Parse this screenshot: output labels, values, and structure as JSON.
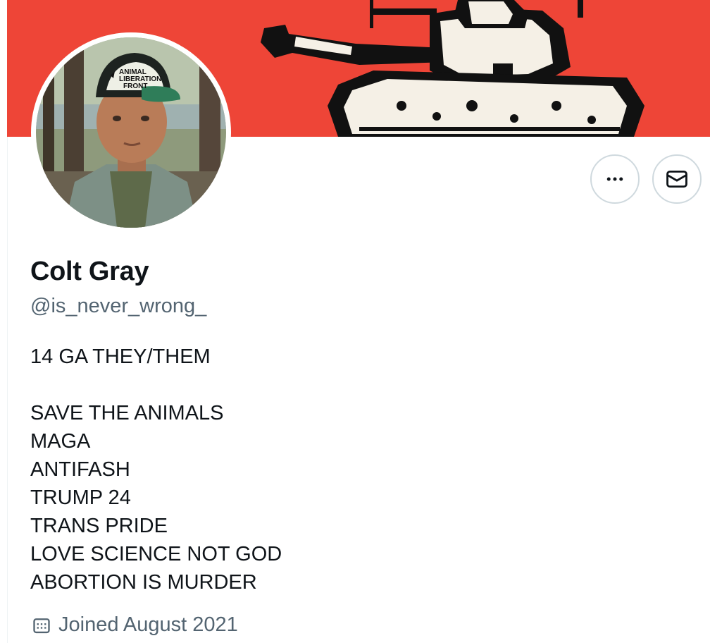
{
  "profile": {
    "display_name": "Colt Gray",
    "handle": "@is_never_wrong_",
    "bio_lines": [
      "14 GA THEY/THEM",
      "",
      "SAVE THE ANIMALS",
      "MAGA",
      "ANTIFASH",
      "TRUMP 24",
      "TRANS PRIDE",
      "LOVE SCIENCE NOT GOD",
      "ABORTION IS MURDER"
    ],
    "joined": "Joined August 2021",
    "hat_text": [
      "ANIMAL",
      "LIBERATION",
      "FRONT"
    ]
  },
  "actions": {
    "more_icon": "more-horizontal-icon",
    "message_icon": "envelope-icon"
  },
  "colors": {
    "banner": "#ee4537",
    "name": "#0f1419",
    "secondary": "#536471",
    "button_border": "#cfd9de"
  }
}
